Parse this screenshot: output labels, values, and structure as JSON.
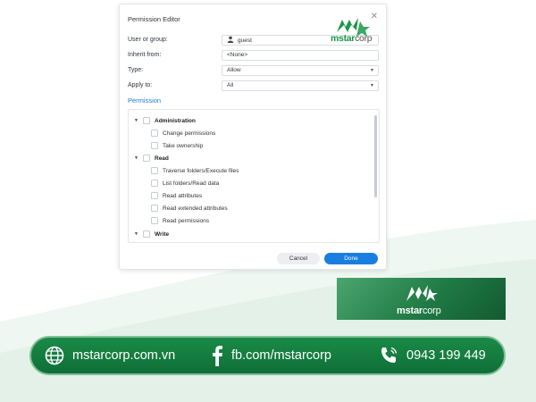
{
  "dialog": {
    "title": "Permission Editor",
    "fields": {
      "user_label": "User or group:",
      "user_value": "guest",
      "inherit_label": "Inherit from:",
      "inherit_value": "<None>",
      "type_label": "Type:",
      "type_value": "Allow",
      "apply_label": "Apply to:",
      "apply_value": "All"
    },
    "permission_heading": "Permission",
    "tree": {
      "administration": "Administration",
      "change_permissions": "Change permissions",
      "take_ownership": "Take ownership",
      "read": "Read",
      "traverse": "Traverse folders/Execute files",
      "list_folders": "List folders/Read data",
      "read_attributes": "Read attributes",
      "read_extended": "Read extended attributes",
      "read_permissions": "Read permissions",
      "write": "Write"
    },
    "cancel_label": "Cancel",
    "done_label": "Done"
  },
  "watermark": {
    "brand_main": "mstar",
    "brand_tail": "corp"
  },
  "brand_card": {
    "brand_main": "mstar",
    "brand_tail": "corp"
  },
  "footer": {
    "website": "mstarcorp.com.vn",
    "facebook": "fb.com/mstarcorp",
    "phone": "0943 199 449"
  },
  "colors": {
    "accent": "#1a7ee0",
    "brand_green": "#1a8a47"
  }
}
